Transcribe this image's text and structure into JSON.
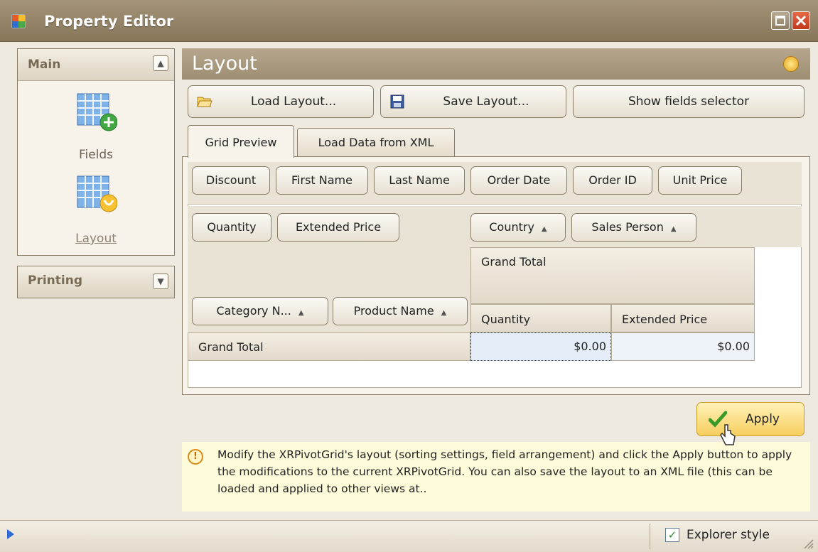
{
  "window": {
    "title": "Property Editor"
  },
  "nav": {
    "main": {
      "header": "Main",
      "items": [
        {
          "label": "Fields",
          "icon": "fields-grid-icon"
        },
        {
          "label": "Layout",
          "icon": "layout-grid-icon"
        }
      ]
    },
    "printing": {
      "header": "Printing"
    }
  },
  "layout": {
    "title": "Layout",
    "buttons": {
      "load": "Load Layout...",
      "save": "Save Layout...",
      "fields": "Show fields selector"
    },
    "tabs": [
      "Grid Preview",
      "Load Data from XML"
    ]
  },
  "pivot": {
    "filter_fields": [
      "Discount",
      "First Name",
      "Last Name",
      "Order Date",
      "Order ID",
      "Unit Price"
    ],
    "data_fields": [
      "Quantity",
      "Extended Price"
    ],
    "column_fields": [
      "Country",
      "Sales Person"
    ],
    "row_fields": [
      "Category N...",
      "Product Name"
    ],
    "column_grand_total": "Grand Total",
    "value_headers": [
      "Quantity",
      "Extended Price"
    ],
    "row_grand_total": "Grand Total",
    "cells": [
      "$0.00",
      "$0.00"
    ]
  },
  "apply": {
    "label": "Apply"
  },
  "info": {
    "text": "Modify the XRPivotGrid's layout (sorting settings, field arrangement) and click the Apply button to apply the modifications to the current XRPivotGrid. You can also save the layout to an XML file (this can be loaded and applied to other views at.."
  },
  "status": {
    "explorer_style": "Explorer style",
    "explorer_checked": true
  },
  "colors": {
    "accent": "#8a7d66",
    "apply": "#f7ce5e",
    "info_bg": "#fdfbd9"
  }
}
